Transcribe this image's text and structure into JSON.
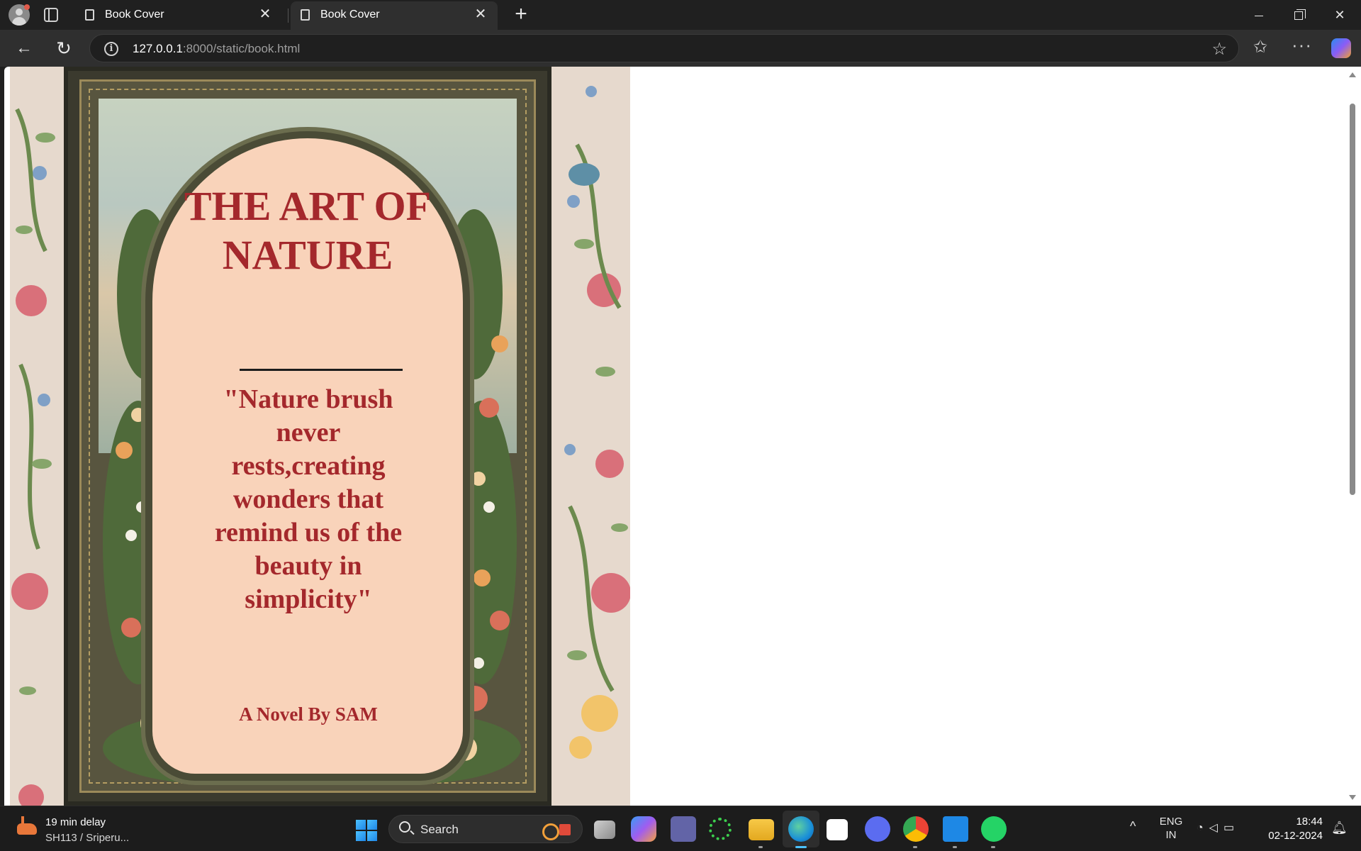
{
  "browser": {
    "tabs": [
      {
        "title": "Book Cover"
      },
      {
        "title": "Book Cover"
      }
    ],
    "url_host": "127.0.0.1",
    "url_rest": ":8000/static/book.html"
  },
  "cover": {
    "title": "THE ART OF NATURE",
    "quote": "\"Nature brush never rests,creating wonders that remind us of the beauty in simplicity\"",
    "author": "A Novel By SAM"
  },
  "colors": {
    "title_red": "#a4282c",
    "arch_peach": "#f9d3ba",
    "wallpaper": "#e6d9cd"
  },
  "taskbar": {
    "weather_line1": "19 min delay",
    "weather_line2": "SH113 / Sriperu...",
    "search_label": "Search",
    "lang_line1": "ENG",
    "lang_line2": "IN",
    "time": "18:44",
    "date": "02-12-2024",
    "apps": [
      "task-view",
      "copilot",
      "teams",
      "refresh-app",
      "file-explorer",
      "edge",
      "store",
      "arc",
      "chrome",
      "vscode",
      "whatsapp"
    ]
  }
}
